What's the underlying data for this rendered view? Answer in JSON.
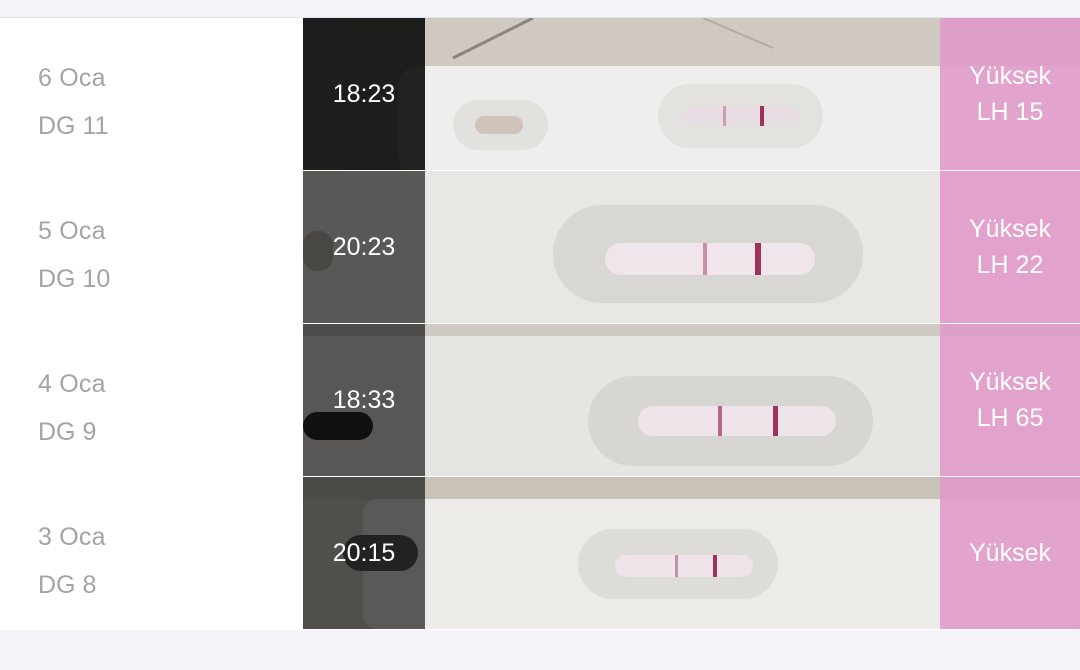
{
  "colors": {
    "background": "#f4f4f8",
    "row_background": "#ffffff",
    "secondary_text": "#a4a4a8",
    "time_overlay": "#3a3a3a",
    "result_badge": "#e098c8",
    "test_line": "#a0305c"
  },
  "entries": [
    {
      "date": "6 Oca",
      "cycle_day": "DG 11",
      "time": "18:23",
      "result": "Yüksek",
      "lh": "LH 15",
      "photo_icon": "ovulation-test-strip-photo"
    },
    {
      "date": "5 Oca",
      "cycle_day": "DG 10",
      "time": "20:23",
      "result": "Yüksek",
      "lh": "LH 22",
      "photo_icon": "ovulation-test-strip-photo"
    },
    {
      "date": "4 Oca",
      "cycle_day": "DG 9",
      "time": "18:33",
      "result": "Yüksek",
      "lh": "LH 65",
      "photo_icon": "ovulation-test-strip-photo"
    },
    {
      "date": "3 Oca",
      "cycle_day": "DG 8",
      "time": "20:15",
      "result": "Yüksek",
      "photo_icon": "ovulation-test-strip-photo"
    }
  ]
}
